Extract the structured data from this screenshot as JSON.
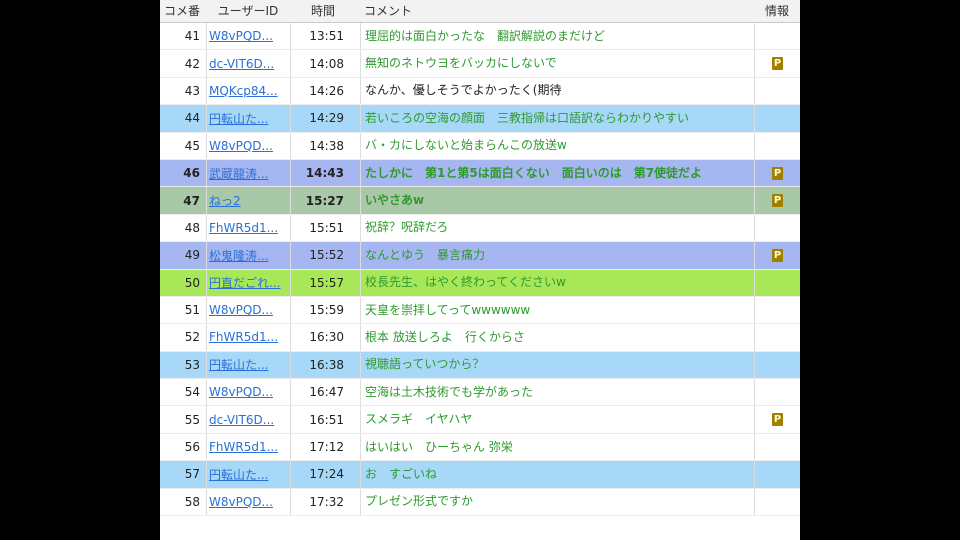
{
  "header": {
    "num": "コメ番",
    "uid": "ユーザーID",
    "time": "時間",
    "comment": "コメント",
    "info": "情報"
  },
  "colors": {
    "light_blue": "#a8d8f8",
    "medium_blue": "#a6b6f0",
    "green_gray": "#a8c8a8",
    "lime": "#a8e858",
    "white": "#ffffff"
  },
  "rows": [
    {
      "num": "41",
      "uid": "W8vPQD...",
      "time": "13:51",
      "comment": "理屈的は面白かったな　翻訳解説のまだけど",
      "info": "",
      "bg": "#ffffff"
    },
    {
      "num": "42",
      "uid": "dc-VIT6D...",
      "time": "14:08",
      "comment": "無知のネトウヨをバッカにしないで",
      "info": "P",
      "bg": "#ffffff"
    },
    {
      "num": "43",
      "uid": "MQKcp84...",
      "time": "14:26",
      "comment": "なんか、優しそうでよかったく(期待",
      "info": "",
      "bg": "#ffffff",
      "black": true
    },
    {
      "num": "44",
      "uid": "円転山た...",
      "time": "14:29",
      "comment": "若いころの空海の顔面　三教指帰は口語訳ならわかりやすい",
      "info": "",
      "bg": "#a8d8f8"
    },
    {
      "num": "45",
      "uid": "W8vPQD...",
      "time": "14:38",
      "comment": "バ・カにしないと始まらんこの放送w",
      "info": "",
      "bg": "#ffffff"
    },
    {
      "num": "46",
      "uid": "武蔵龍涛...",
      "time": "14:43",
      "comment": "たしかに　第1と第5は面白くない　面白いのは　第7使徒だよ",
      "info": "P",
      "bg": "#a6b6f0",
      "bold": true
    },
    {
      "num": "47",
      "uid": "ねっ2",
      "time": "15:27",
      "comment": "いやさあw",
      "info": "P",
      "bg": "#a8c8a8",
      "bold": true
    },
    {
      "num": "48",
      "uid": "FhWR5d1...",
      "time": "15:51",
      "comment": "祝辞？呪辞だろ",
      "info": "",
      "bg": "#ffffff"
    },
    {
      "num": "49",
      "uid": "松鬼隆涛...",
      "time": "15:52",
      "comment": "なんとゆう　暴言痛力",
      "info": "P",
      "bg": "#a6b6f0"
    },
    {
      "num": "50",
      "uid": "円直だごれ...",
      "time": "15:57",
      "comment": "校長先生、はやく終わってくださいw",
      "info": "",
      "bg": "#a8e858"
    },
    {
      "num": "51",
      "uid": "W8vPQD...",
      "time": "15:59",
      "comment": "天皇を崇拝してってwwwwww",
      "info": "",
      "bg": "#ffffff"
    },
    {
      "num": "52",
      "uid": "FhWR5d1...",
      "time": "16:30",
      "comment": "根本 放送しろよ　行くからさ",
      "info": "",
      "bg": "#ffffff"
    },
    {
      "num": "53",
      "uid": "円転山た...",
      "time": "16:38",
      "comment": "視聴語っていつから？",
      "info": "",
      "bg": "#a8d8f8"
    },
    {
      "num": "54",
      "uid": "W8vPQD...",
      "time": "16:47",
      "comment": "空海は土木技術でも学があった",
      "info": "",
      "bg": "#ffffff"
    },
    {
      "num": "55",
      "uid": "dc-VIT6D...",
      "time": "16:51",
      "comment": "スメラギ　イヤハヤ",
      "info": "P",
      "bg": "#ffffff"
    },
    {
      "num": "56",
      "uid": "FhWR5d1...",
      "time": "17:12",
      "comment": "はいはい　ひーちゃん 弥栄",
      "info": "",
      "bg": "#ffffff"
    },
    {
      "num": "57",
      "uid": "円転山た...",
      "time": "17:24",
      "comment": "お　すごいね",
      "info": "",
      "bg": "#a8d8f8"
    },
    {
      "num": "58",
      "uid": "W8vPQD...",
      "time": "17:32",
      "comment": "プレゼン形式ですか",
      "info": "",
      "bg": "#ffffff"
    }
  ]
}
